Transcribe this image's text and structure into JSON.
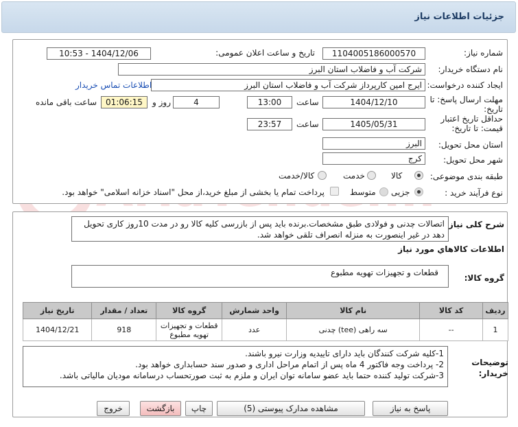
{
  "header": {
    "title": "جزئیات اطلاعات نیاز"
  },
  "form": {
    "need_number_label": "شماره نیاز:",
    "need_number": "1104005186000570",
    "announce_label": "تاریخ و ساعت اعلان عمومی:",
    "announce_value": "1404/12/06 - 10:53",
    "buyer_org_label": "نام دستگاه خریدار:",
    "buyer_org": "شرکت آب و فاضلاب استان البرز",
    "creator_label": "ایجاد کننده درخواست:",
    "creator": "ایرج امین کارپرداز شرکت آب و فاضلاب استان البرز",
    "contact_link": "اطلاعات تماس خریدار",
    "deadline_label_1": "مهلت ارسال پاسخ: تا",
    "deadline_label_2": "تاریخ:",
    "deadline_date": "1404/12/10",
    "time_label": "ساعت",
    "deadline_time": "13:00",
    "days_value": "4",
    "days_label": "روز و",
    "remaining_time": "01:06:15",
    "remaining_label": "ساعت باقی مانده",
    "validity_label_1": "حداقل تاریخ اعتبار",
    "validity_label_2": "قیمت: تا تاریخ:",
    "validity_date": "1405/05/31",
    "validity_time": "23:57",
    "province_label": "استان محل تحویل:",
    "province": "البرز",
    "city_label": "شهر محل تحویل:",
    "city": "کرج",
    "category_label": "طبقه بندی موضوعی:",
    "category_options": [
      "کالا",
      "خدمت",
      "کالا/خدمت"
    ],
    "purchase_type_label": "نوع فرآیند خرید :",
    "purchase_options": [
      "جزیی",
      "متوسط"
    ],
    "payment_note": "پرداخت تمام یا بخشی از مبلغ خرید،از محل \"اسناد خزانه اسلامی\" خواهد بود."
  },
  "details": {
    "general_desc_label": "شرح کلی نیاز:",
    "general_desc": "اتصالات چدنی و فولادی طبق مشخصات.برنده باید پس از بازرسی کلیه کالا رو در مدت 10روز کاری تحویل دهد در غیر اینصورت به منزله انصراف تلقی خواهد شد.",
    "goods_info_title": "اطلاعات کالاهاي مورد نیاز",
    "goods_group_label": "گروه کالا:",
    "goods_group": "قطعات و تجهیزات تهویه مطبوع",
    "table": {
      "headers": [
        "ردیف",
        "کد کالا",
        "نام کالا",
        "واحد شمارش",
        "گروه کالا",
        "تعداد / مقدار",
        "تاریخ نیاز"
      ],
      "rows": [
        [
          "1",
          "--",
          "سه راهی (tee) چدنی",
          "عدد",
          "قطعات و تجهیزات تهویه مطبوع",
          "918",
          "1404/12/21"
        ]
      ]
    },
    "buyer_notes_label": "توضیحات خریدار:",
    "buyer_notes": [
      "1-کلیه شرکت کنندگان باید دارای تاییدیه وزارت نیرو باشند.",
      "2- پرداخت وجه فاکتور 4 ماه پس از اتمام مراحل اداری و صدور سند حسابداری خواهد بود.",
      "3-شرکت تولید کننده حتما باید عضو سامانه توان ایران و ملزم به ثبت صورتحساب درسامانه مودیان مالیاتی باشد."
    ]
  },
  "buttons": {
    "reply": "پاسخ به نیاز",
    "attachments": "مشاهده مدارک پیوستی (5)",
    "print": "چاپ",
    "back": "بازگشت",
    "exit": "خروج"
  },
  "watermark": {
    "text": "AriaTender.net"
  },
  "colors": {
    "header_bg": "#c7d8ea",
    "highlight_field": "#fff7c6",
    "link": "#1b4fb4",
    "pink_button": "#f3bcbc"
  }
}
